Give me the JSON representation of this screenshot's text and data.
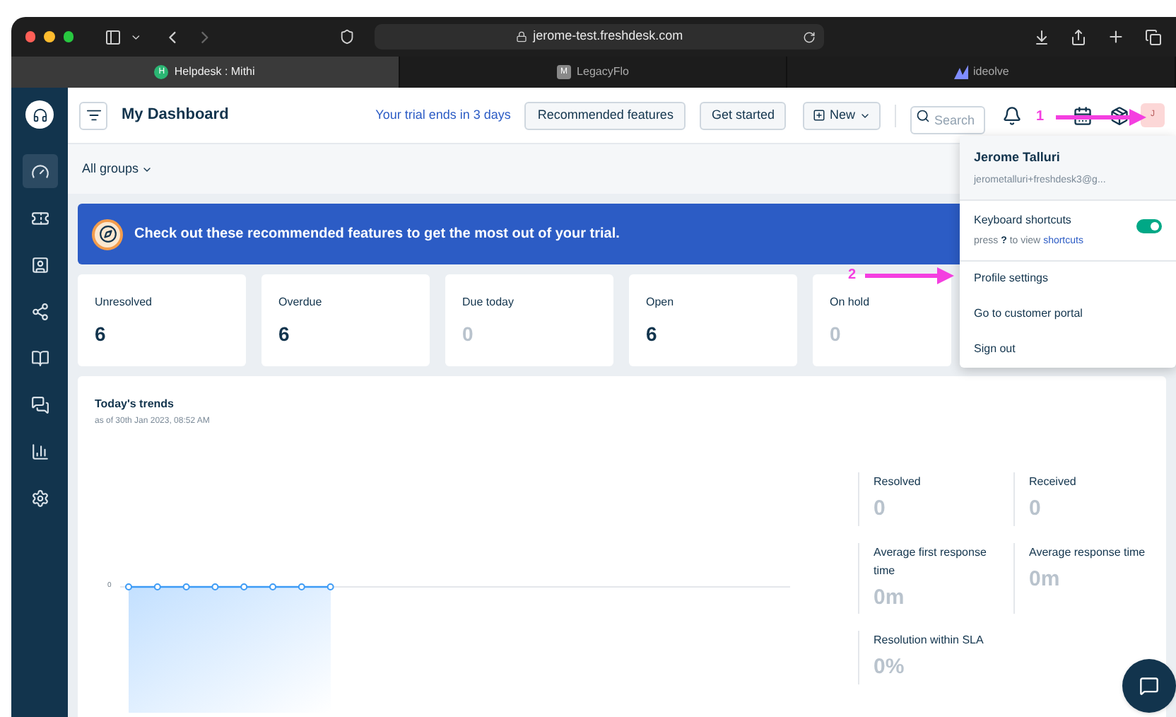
{
  "browser": {
    "url": "jerome-test.freshdesk.com",
    "tabs": [
      {
        "title": "Helpdesk : Mithi",
        "selected": true,
        "favicon": "H"
      },
      {
        "title": "LegacyFlo",
        "selected": false,
        "favicon": "M"
      },
      {
        "title": "ideolve",
        "selected": false
      }
    ]
  },
  "sidebar": {
    "items": [
      {
        "kind": "dashboard",
        "selected": true
      },
      {
        "kind": "tickets",
        "selected": false
      },
      {
        "kind": "contacts",
        "selected": false
      },
      {
        "kind": "groups",
        "selected": false
      },
      {
        "kind": "solutions",
        "selected": false
      },
      {
        "kind": "discussions",
        "selected": false
      },
      {
        "kind": "reports",
        "selected": false
      },
      {
        "kind": "admin",
        "selected": false
      }
    ]
  },
  "header": {
    "title": "My Dashboard",
    "trial_link": "Your trial ends in 3 days",
    "buttons": [
      "Recommended features",
      "Get started"
    ],
    "new_button": "New",
    "search": {
      "placeholder": "Search"
    },
    "avatar": "J"
  },
  "filter": {
    "label": "All groups"
  },
  "banner": {
    "text": "Check out these recommended features to get the most out of your trial."
  },
  "ticket_cards": [
    {
      "label": "Unresolved",
      "value": "6",
      "muted": false
    },
    {
      "label": "Overdue",
      "value": "6",
      "muted": false
    },
    {
      "label": "Due today",
      "value": "0",
      "muted": true
    },
    {
      "label": "Open",
      "value": "6",
      "muted": false
    },
    {
      "label": "On hold",
      "value": "0",
      "muted": true
    }
  ],
  "trends": {
    "title": "Today's trends",
    "subtitle": "as of 30th Jan 2023, 08:52 AM",
    "y_tick": "0",
    "stats": [
      {
        "label": "Resolved",
        "value": "0"
      },
      {
        "label": "Received",
        "value": "0"
      },
      {
        "label": "Average first response time",
        "value": "0m"
      },
      {
        "label": "Average response time",
        "value": "0m"
      },
      {
        "label": "Resolution within SLA",
        "value": "0%"
      }
    ]
  },
  "profile_menu": {
    "name": "Jerome Talluri",
    "email": "jerometalluri+freshdesk3@g...",
    "shortcuts": {
      "label": "Keyboard shortcuts",
      "hint_before": "press",
      "hint_key": "?",
      "hint_middle": "to view",
      "hint_link": "shortcuts",
      "on": true
    },
    "items": [
      "Profile settings",
      "Go to customer portal",
      "Sign out"
    ]
  },
  "annotations": [
    {
      "label": "1"
    },
    {
      "label": "2"
    }
  ]
}
